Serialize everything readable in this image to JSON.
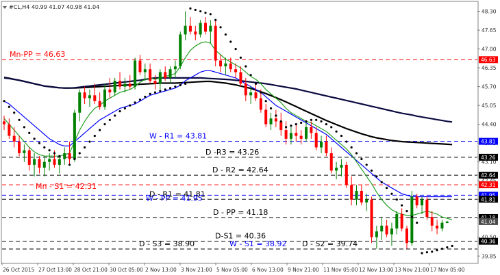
{
  "chart_data": {
    "type": "candlestick",
    "title": "#CL,H4  40.99 41.07 40.98 41.04",
    "ylim": [
      39.62,
      48.62
    ],
    "price_ticks": [
      "48.30",
      "47.65",
      "47.00",
      "46.35",
      "45.70",
      "45.05",
      "44.40",
      "43.75",
      "43.10",
      "42.45",
      "41.80",
      "41.15",
      "40.50",
      "39.85"
    ],
    "time_labels": [
      "26 Oct 2015",
      "27 Oct 13:00",
      "28 Oct 21:00",
      "30 Oct 05:00",
      "2 Nov 13:00",
      "3 Nov 21:00",
      "5 Nov 05:00",
      "6 Nov 13:00",
      "9 Nov 21:00",
      "11 Nov 05:00",
      "12 Nov 13:00",
      "13 Nov 21:00",
      "17 Nov 05:00"
    ],
    "levels": [
      {
        "name": "Mn-PP",
        "value": 46.63,
        "label": "Mn-PP = 46.63",
        "color": "#ff0000",
        "tag": "46.63"
      },
      {
        "name": "W-R1",
        "value": 43.81,
        "label": "W - R1 = 43.81",
        "color": "#0000ff",
        "tag": "43.81"
      },
      {
        "name": "D-R3",
        "value": 43.26,
        "label": "D -R3 = 43.26",
        "color": "#000000",
        "tag": "43.26"
      },
      {
        "name": "D-R2",
        "value": 42.64,
        "label": "D - R2 = 42.64",
        "color": "#000000",
        "tag": "42.64"
      },
      {
        "name": "Mn-S1",
        "value": 42.31,
        "label": "Mn - S1 = 42.31",
        "color": "#ff0000",
        "tag": "42.31"
      },
      {
        "name": "W-PP",
        "value": 41.95,
        "label": "W - PP = 41.95",
        "color": "#0000ff",
        "tag": "41.95"
      },
      {
        "name": "D-R1",
        "value": 41.81,
        "label": "D - R1 = 41.81",
        "color": "#000000",
        "tag": "41.81"
      },
      {
        "name": "D-PP",
        "value": 41.18,
        "label": "D - PP = 41.18",
        "color": "#000000",
        "tag": "41.18"
      },
      {
        "name": "D-S1",
        "value": 40.36,
        "label": "D-S1 = 40.36",
        "color": "#000000",
        "tag": "40.36"
      },
      {
        "name": "D-S3",
        "value": 38.9,
        "label": "D - S3 = 38.90",
        "color": "#000000",
        "tag": ""
      },
      {
        "name": "W-S1",
        "value": 38.92,
        "label": "W - S1 = 38.92",
        "color": "#0000ff",
        "tag": ""
      },
      {
        "name": "D-S2",
        "value": 39.74,
        "label": "D - S2 = 39.74",
        "color": "#000000",
        "tag": ""
      }
    ],
    "current_price": {
      "value": 41.04,
      "tag": "41.04"
    },
    "colors": {
      "up": "#008000",
      "down": "#ff0000",
      "fast_ma": "#22a022",
      "mid_ma": "#0000ff",
      "slow_ma": "#0a0a40",
      "slowest_ma": "#000000",
      "sar": "#000000",
      "grid": "#c0c0c0"
    },
    "candles": [
      {
        "o": 44.5,
        "h": 44.7,
        "l": 44.2,
        "c": 44.4
      },
      {
        "o": 44.4,
        "h": 44.6,
        "l": 43.9,
        "c": 44.0
      },
      {
        "o": 44.0,
        "h": 44.3,
        "l": 43.6,
        "c": 43.8
      },
      {
        "o": 43.8,
        "h": 44.0,
        "l": 43.3,
        "c": 43.4
      },
      {
        "o": 43.4,
        "h": 43.7,
        "l": 43.1,
        "c": 43.5
      },
      {
        "o": 43.5,
        "h": 43.6,
        "l": 42.8,
        "c": 43.0
      },
      {
        "o": 43.0,
        "h": 43.4,
        "l": 42.6,
        "c": 43.2
      },
      {
        "o": 43.2,
        "h": 43.3,
        "l": 42.7,
        "c": 42.9
      },
      {
        "o": 42.9,
        "h": 43.3,
        "l": 42.6,
        "c": 43.1
      },
      {
        "o": 43.1,
        "h": 43.4,
        "l": 42.8,
        "c": 43.2
      },
      {
        "o": 43.2,
        "h": 43.5,
        "l": 42.9,
        "c": 43.0
      },
      {
        "o": 43.0,
        "h": 43.3,
        "l": 42.7,
        "c": 43.2
      },
      {
        "o": 43.2,
        "h": 43.6,
        "l": 43.0,
        "c": 43.4
      },
      {
        "o": 43.4,
        "h": 43.8,
        "l": 43.0,
        "c": 43.2
      },
      {
        "o": 43.2,
        "h": 44.9,
        "l": 43.1,
        "c": 44.8
      },
      {
        "o": 44.8,
        "h": 45.6,
        "l": 44.5,
        "c": 45.5
      },
      {
        "o": 45.5,
        "h": 45.7,
        "l": 45.1,
        "c": 45.3
      },
      {
        "o": 45.3,
        "h": 45.6,
        "l": 45.0,
        "c": 45.4
      },
      {
        "o": 45.4,
        "h": 45.8,
        "l": 45.1,
        "c": 45.2
      },
      {
        "o": 45.2,
        "h": 45.5,
        "l": 44.9,
        "c": 45.0
      },
      {
        "o": 45.0,
        "h": 45.8,
        "l": 44.9,
        "c": 45.6
      },
      {
        "o": 45.6,
        "h": 46.0,
        "l": 45.3,
        "c": 45.5
      },
      {
        "o": 45.5,
        "h": 46.0,
        "l": 45.4,
        "c": 45.9
      },
      {
        "o": 45.9,
        "h": 46.2,
        "l": 45.6,
        "c": 45.7
      },
      {
        "o": 45.7,
        "h": 46.0,
        "l": 45.5,
        "c": 45.8
      },
      {
        "o": 45.8,
        "h": 46.1,
        "l": 45.6,
        "c": 45.7
      },
      {
        "o": 45.7,
        "h": 46.7,
        "l": 45.6,
        "c": 46.6
      },
      {
        "o": 46.6,
        "h": 46.8,
        "l": 46.1,
        "c": 46.2
      },
      {
        "o": 46.2,
        "h": 46.5,
        "l": 45.9,
        "c": 46.3
      },
      {
        "o": 46.3,
        "h": 46.5,
        "l": 45.8,
        "c": 45.9
      },
      {
        "o": 45.9,
        "h": 46.1,
        "l": 45.6,
        "c": 45.8
      },
      {
        "o": 45.8,
        "h": 46.3,
        "l": 45.6,
        "c": 46.2
      },
      {
        "o": 46.2,
        "h": 46.4,
        "l": 45.9,
        "c": 46.0
      },
      {
        "o": 46.0,
        "h": 46.4,
        "l": 45.8,
        "c": 46.3
      },
      {
        "o": 46.3,
        "h": 46.6,
        "l": 46.0,
        "c": 46.4
      },
      {
        "o": 46.4,
        "h": 47.6,
        "l": 46.3,
        "c": 47.5
      },
      {
        "o": 47.5,
        "h": 48.3,
        "l": 47.3,
        "c": 47.8
      },
      {
        "o": 47.8,
        "h": 48.1,
        "l": 47.5,
        "c": 47.6
      },
      {
        "o": 47.6,
        "h": 47.8,
        "l": 47.3,
        "c": 47.5
      },
      {
        "o": 47.5,
        "h": 48.0,
        "l": 47.4,
        "c": 47.9
      },
      {
        "o": 47.9,
        "h": 48.1,
        "l": 47.5,
        "c": 47.6
      },
      {
        "o": 47.6,
        "h": 48.0,
        "l": 47.2,
        "c": 47.8
      },
      {
        "o": 47.8,
        "h": 48.0,
        "l": 46.4,
        "c": 46.6
      },
      {
        "o": 46.6,
        "h": 46.8,
        "l": 46.2,
        "c": 46.4
      },
      {
        "o": 46.4,
        "h": 46.7,
        "l": 46.1,
        "c": 46.5
      },
      {
        "o": 46.5,
        "h": 46.7,
        "l": 46.2,
        "c": 46.3
      },
      {
        "o": 46.3,
        "h": 46.5,
        "l": 46.0,
        "c": 46.2
      },
      {
        "o": 46.2,
        "h": 46.4,
        "l": 45.7,
        "c": 45.8
      },
      {
        "o": 45.8,
        "h": 46.0,
        "l": 45.2,
        "c": 45.4
      },
      {
        "o": 45.4,
        "h": 45.7,
        "l": 45.1,
        "c": 45.5
      },
      {
        "o": 45.5,
        "h": 45.8,
        "l": 45.2,
        "c": 45.3
      },
      {
        "o": 45.3,
        "h": 45.6,
        "l": 44.8,
        "c": 44.9
      },
      {
        "o": 44.9,
        "h": 45.1,
        "l": 44.3,
        "c": 44.4
      },
      {
        "o": 44.4,
        "h": 44.8,
        "l": 44.2,
        "c": 44.6
      },
      {
        "o": 44.6,
        "h": 44.9,
        "l": 44.3,
        "c": 44.5
      },
      {
        "o": 44.5,
        "h": 44.8,
        "l": 44.0,
        "c": 44.2
      },
      {
        "o": 44.2,
        "h": 44.5,
        "l": 43.7,
        "c": 43.9
      },
      {
        "o": 43.9,
        "h": 44.3,
        "l": 43.7,
        "c": 44.1
      },
      {
        "o": 44.1,
        "h": 44.4,
        "l": 43.8,
        "c": 44.0
      },
      {
        "o": 44.0,
        "h": 44.2,
        "l": 43.7,
        "c": 43.9
      },
      {
        "o": 43.9,
        "h": 44.5,
        "l": 43.8,
        "c": 44.3
      },
      {
        "o": 44.3,
        "h": 44.5,
        "l": 43.9,
        "c": 44.1
      },
      {
        "o": 44.1,
        "h": 44.3,
        "l": 43.5,
        "c": 43.6
      },
      {
        "o": 43.6,
        "h": 44.0,
        "l": 43.4,
        "c": 43.8
      },
      {
        "o": 43.8,
        "h": 44.0,
        "l": 43.3,
        "c": 43.4
      },
      {
        "o": 43.4,
        "h": 43.6,
        "l": 42.7,
        "c": 42.8
      },
      {
        "o": 42.8,
        "h": 43.1,
        "l": 42.5,
        "c": 42.9
      },
      {
        "o": 42.9,
        "h": 43.2,
        "l": 42.6,
        "c": 43.0
      },
      {
        "o": 43.0,
        "h": 43.1,
        "l": 42.2,
        "c": 42.3
      },
      {
        "o": 42.3,
        "h": 42.6,
        "l": 41.6,
        "c": 41.8
      },
      {
        "o": 41.8,
        "h": 42.3,
        "l": 41.6,
        "c": 42.1
      },
      {
        "o": 42.1,
        "h": 42.3,
        "l": 41.6,
        "c": 41.7
      },
      {
        "o": 41.7,
        "h": 42.0,
        "l": 41.4,
        "c": 41.8
      },
      {
        "o": 41.8,
        "h": 41.9,
        "l": 40.3,
        "c": 40.5
      },
      {
        "o": 40.5,
        "h": 40.9,
        "l": 40.1,
        "c": 40.7
      },
      {
        "o": 40.7,
        "h": 41.2,
        "l": 40.4,
        "c": 40.9
      },
      {
        "o": 40.9,
        "h": 41.1,
        "l": 40.5,
        "c": 40.6
      },
      {
        "o": 40.6,
        "h": 41.0,
        "l": 40.2,
        "c": 40.8
      },
      {
        "o": 40.8,
        "h": 41.4,
        "l": 40.6,
        "c": 41.3
      },
      {
        "o": 41.3,
        "h": 41.5,
        "l": 40.7,
        "c": 40.8
      },
      {
        "o": 40.8,
        "h": 40.9,
        "l": 40.1,
        "c": 40.3
      },
      {
        "o": 40.3,
        "h": 42.1,
        "l": 40.2,
        "c": 41.9
      },
      {
        "o": 41.9,
        "h": 42.0,
        "l": 41.5,
        "c": 41.6
      },
      {
        "o": 41.6,
        "h": 41.9,
        "l": 41.3,
        "c": 41.8
      },
      {
        "o": 41.8,
        "h": 41.9,
        "l": 41.1,
        "c": 41.2
      },
      {
        "o": 41.2,
        "h": 41.4,
        "l": 40.7,
        "c": 40.9
      },
      {
        "o": 40.9,
        "h": 41.1,
        "l": 40.6,
        "c": 40.8
      },
      {
        "o": 40.8,
        "h": 41.1,
        "l": 40.7,
        "c": 41.0
      },
      {
        "o": 40.99,
        "h": 41.07,
        "l": 40.98,
        "c": 41.04
      }
    ],
    "ma_fast": [
      44.6,
      44.4,
      44.2,
      44.0,
      43.8,
      43.6,
      43.45,
      43.35,
      43.3,
      43.3,
      43.3,
      43.3,
      43.35,
      43.4,
      43.8,
      44.2,
      44.5,
      44.75,
      44.95,
      45.05,
      45.2,
      45.3,
      45.4,
      45.5,
      45.55,
      45.6,
      45.7,
      45.85,
      45.95,
      46.0,
      45.95,
      46.0,
      46.05,
      46.1,
      46.15,
      46.4,
      46.7,
      46.95,
      47.1,
      47.2,
      47.25,
      47.2,
      46.95,
      46.8,
      46.65,
      46.55,
      46.45,
      46.35,
      46.2,
      46.05,
      45.95,
      45.8,
      45.6,
      45.45,
      45.3,
      45.15,
      44.95,
      44.8,
      44.7,
      44.6,
      44.5,
      44.45,
      44.35,
      44.25,
      44.15,
      44.0,
      43.85,
      43.7,
      43.55,
      43.35,
      43.1,
      42.85,
      42.6,
      42.35,
      42.05,
      41.8,
      41.6,
      41.45,
      41.35,
      41.3,
      41.25,
      41.25,
      41.3,
      41.35,
      41.4,
      41.35,
      41.3,
      41.2,
      41.15,
      41.1
    ],
    "ma_mid": [
      45.2,
      45.1,
      44.95,
      44.8,
      44.65,
      44.5,
      44.35,
      44.2,
      44.05,
      43.9,
      43.8,
      43.7,
      43.65,
      43.65,
      43.8,
      43.95,
      44.1,
      44.25,
      44.4,
      44.55,
      44.65,
      44.75,
      44.85,
      44.95,
      45.0,
      45.05,
      45.1,
      45.2,
      45.3,
      45.4,
      45.45,
      45.5,
      45.55,
      45.6,
      45.65,
      45.75,
      45.9,
      46.0,
      46.1,
      46.2,
      46.25,
      46.25,
      46.2,
      46.15,
      46.1,
      46.05,
      46.0,
      45.9,
      45.8,
      45.7,
      45.6,
      45.5,
      45.35,
      45.2,
      45.05,
      44.95,
      44.85,
      44.75,
      44.65,
      44.55,
      44.45,
      44.35,
      44.25,
      44.15,
      44.05,
      43.9,
      43.75,
      43.6,
      43.45,
      43.3,
      43.15,
      43.0,
      42.85,
      42.7,
      42.55,
      42.4,
      42.3,
      42.2,
      42.1,
      42.0,
      41.95,
      41.9,
      41.9,
      41.9,
      41.9,
      41.9,
      41.9,
      41.9,
      41.9,
      41.9
    ],
    "ma_slow": [
      46.0,
      45.98,
      45.95,
      45.92,
      45.88,
      45.84,
      45.8,
      45.76,
      45.72,
      45.7,
      45.68,
      45.66,
      45.65,
      45.65,
      45.66,
      45.68,
      45.7,
      45.72,
      45.74,
      45.76,
      45.78,
      45.8,
      45.82,
      45.84,
      45.86,
      45.88,
      45.9,
      45.92,
      45.95,
      45.98,
      46.0,
      46.0,
      46.0,
      46.0,
      46.0,
      46.0,
      46.0,
      46.0,
      46.0,
      46.0,
      45.99,
      45.98,
      45.97,
      45.96,
      45.95,
      45.94,
      45.92,
      45.9,
      45.88,
      45.86,
      45.84,
      45.82,
      45.8,
      45.77,
      45.74,
      45.71,
      45.68,
      45.65,
      45.62,
      45.58,
      45.54,
      45.5,
      45.46,
      45.42,
      45.38,
      45.34,
      45.3,
      45.26,
      45.22,
      45.18,
      45.14,
      45.1,
      45.06,
      45.02,
      44.98,
      44.94,
      44.9,
      44.86,
      44.82,
      44.78,
      44.75,
      44.72,
      44.68,
      44.65,
      44.62,
      44.59,
      44.56,
      44.53,
      44.5,
      44.48
    ],
    "ma_slowest": [
      46.02,
      45.99,
      45.95,
      45.92,
      45.88,
      45.84,
      45.8,
      45.76,
      45.72,
      45.7,
      45.68,
      45.66,
      45.65,
      45.65,
      45.65,
      45.66,
      45.67,
      45.68,
      45.69,
      45.7,
      45.71,
      45.72,
      45.73,
      45.74,
      45.75,
      45.76,
      45.77,
      45.78,
      45.79,
      45.8,
      45.81,
      45.82,
      45.82,
      45.82,
      45.82,
      45.83,
      45.84,
      45.85,
      45.86,
      45.87,
      45.88,
      45.88,
      45.86,
      45.84,
      45.82,
      45.79,
      45.76,
      45.72,
      45.68,
      45.64,
      45.58,
      45.52,
      45.46,
      45.39,
      45.32,
      45.25,
      45.17,
      45.09,
      45.01,
      44.93,
      44.85,
      44.77,
      44.69,
      44.61,
      44.53,
      44.46,
      44.39,
      44.32,
      44.25,
      44.19,
      44.13,
      44.07,
      44.02,
      43.97,
      43.93,
      43.9,
      43.87,
      43.84,
      43.82,
      43.8,
      43.79,
      43.78,
      43.77,
      43.76,
      43.75,
      43.74,
      43.73,
      43.72,
      43.71,
      43.7
    ],
    "sar": [
      45.2,
      45.0,
      44.8,
      44.55,
      44.3,
      44.1,
      43.9,
      43.75,
      43.6,
      43.5,
      43.4,
      43.3,
      null,
      null,
      null,
      null,
      null,
      null,
      null,
      null,
      null,
      null,
      null,
      null,
      null,
      null,
      null,
      null,
      null,
      null,
      null,
      null,
      null,
      null,
      null,
      null,
      null,
      48.4,
      48.35,
      48.3,
      48.25,
      48.2,
      48.0,
      47.75,
      47.5,
      47.25,
      47.0,
      46.7,
      46.4,
      46.1,
      45.8,
      45.5,
      45.2,
      44.95,
      44.7,
      44.5,
      44.3,
      44.35,
      44.4,
      44.45,
      44.5,
      44.55,
      44.55,
      44.5,
      44.4,
      44.3,
      44.15,
      44.0,
      43.8,
      43.6,
      43.4,
      43.2,
      43.0,
      42.8,
      42.6,
      42.4,
      42.2,
      42.0,
      41.8,
      41.6,
      41.4,
      41.2,
      41.0,
      null,
      null,
      null,
      null,
      null,
      null,
      null
    ],
    "sar_low": [
      null,
      null,
      null,
      null,
      null,
      null,
      null,
      null,
      null,
      null,
      null,
      null,
      null,
      43.0,
      43.2,
      43.4,
      43.6,
      43.8,
      44.0,
      44.2,
      44.4,
      44.55,
      44.7,
      44.85,
      44.95,
      45.05,
      45.15,
      45.25,
      45.35,
      45.45,
      45.5,
      45.55,
      45.6,
      45.65,
      45.7,
      45.75,
      45.8,
      null,
      null,
      null,
      null,
      null,
      null,
      null,
      null,
      null,
      null,
      null,
      null,
      null,
      null,
      null,
      null,
      null,
      null,
      null,
      null,
      null,
      null,
      null,
      null,
      null,
      null,
      null,
      null,
      null,
      null,
      null,
      null,
      null,
      null,
      null,
      null,
      null,
      null,
      null,
      null,
      null,
      null,
      null,
      null,
      null,
      null,
      39.95,
      39.98,
      40.0,
      40.05,
      40.1,
      40.15,
      40.2
    ]
  }
}
